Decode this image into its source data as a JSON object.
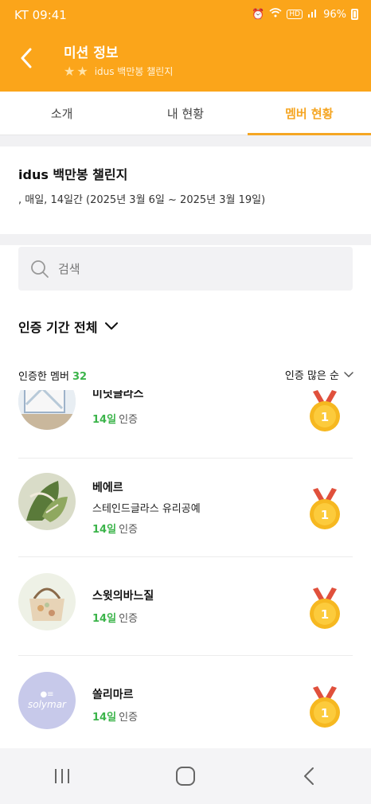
{
  "status_bar": {
    "carrier_time": "KT 09:41",
    "battery": "96%",
    "hd": "HD"
  },
  "header": {
    "title": "미션 정보",
    "subtitle": "idus 백만봉 챌린지"
  },
  "tabs": [
    {
      "label": "소개"
    },
    {
      "label": "내 현황"
    },
    {
      "label": "멤버 현황",
      "active": true
    }
  ],
  "mission": {
    "title": "idus 백만봉 챌린지",
    "schedule": ", 매일, 14일간 (2025년 3월 6일 ~ 2025년 3월 19일)"
  },
  "search": {
    "placeholder": "검색"
  },
  "filter": {
    "period_label": "인증 기간 전체"
  },
  "members": {
    "header_label": "인증한 멤버",
    "count": "32",
    "sort_label": "인증 많은 순",
    "items": [
      {
        "name": "미닛글라스",
        "shop": "",
        "days": "14일",
        "suffix": "인증",
        "medal": "1"
      },
      {
        "name": "베에르",
        "shop": "스테인드글라스 유리공예",
        "days": "14일",
        "suffix": "인증",
        "medal": "1"
      },
      {
        "name": "스윗의바느질",
        "shop": "",
        "days": "14일",
        "suffix": "인증",
        "medal": "1"
      },
      {
        "name": "쏠리마르",
        "shop": "",
        "days": "14일",
        "suffix": "인증",
        "medal": "1",
        "avatar_text": "solymar"
      }
    ]
  },
  "colors": {
    "accent": "#FBA51A",
    "tab_active": "#F5A623",
    "green": "#3BB44A",
    "medal": "#F6B820",
    "ribbon": "#E0503C"
  }
}
